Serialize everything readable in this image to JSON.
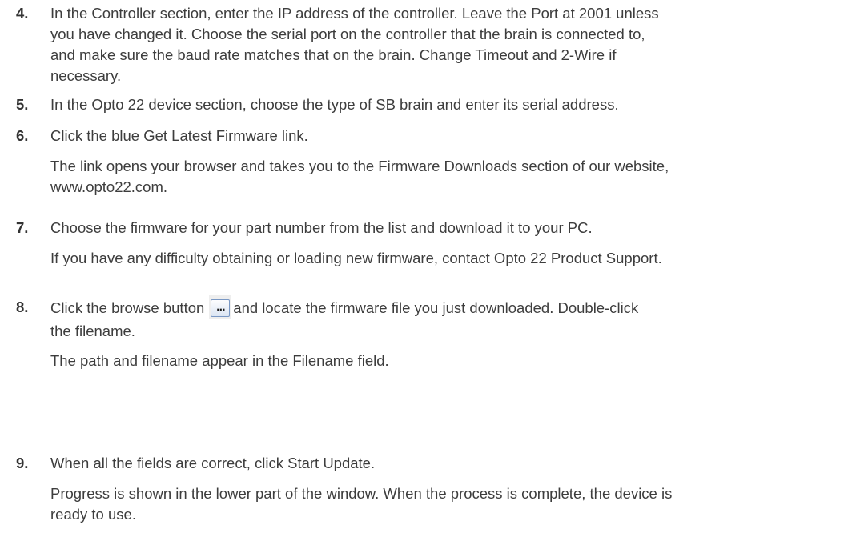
{
  "steps": [
    {
      "number": "4.",
      "lines": [
        "In the Controller section, enter the IP address of the controller. Leave the Port at 2001 unless",
        "you have changed it. Choose the serial port on the controller that the brain is connected to,",
        "and make sure the baud rate matches that on the brain. Change Timeout and 2-Wire if",
        "necessary."
      ]
    },
    {
      "number": "5.",
      "lines": [
        "In the Opto 22 device section, choose the type of SB brain and enter its serial address."
      ]
    },
    {
      "number": "6.",
      "lines": [
        "Click the blue Get Latest Firmware link."
      ],
      "note_lines": [
        "The link opens your browser and takes you to the Firmware Downloads section of our website,",
        "www.opto22.com."
      ]
    },
    {
      "number": "7.",
      "lines": [
        "Choose the firmware for your part number from the list and download it to your PC."
      ],
      "note_lines": [
        "If you have any difficulty obtaining or loading new firmware, contact Opto 22 Product Support."
      ]
    },
    {
      "number": "8.",
      "line1_before": "Click the browse button",
      "browse_button_label": "...",
      "line1_after": "and locate the firmware file you just downloaded. Double-click",
      "line2": "the filename.",
      "note_lines": [
        "The path and filename appear in the Filename field."
      ]
    },
    {
      "number": "9.",
      "lines": [
        "When all the fields are correct, click Start Update."
      ],
      "note_lines": [
        "Progress is shown in the lower part of the window. When the process is complete, the device is",
        "ready to use."
      ]
    }
  ],
  "colors": {
    "text": "#3d3d3d",
    "number": "#333333",
    "button_border": "#7a98c4"
  }
}
